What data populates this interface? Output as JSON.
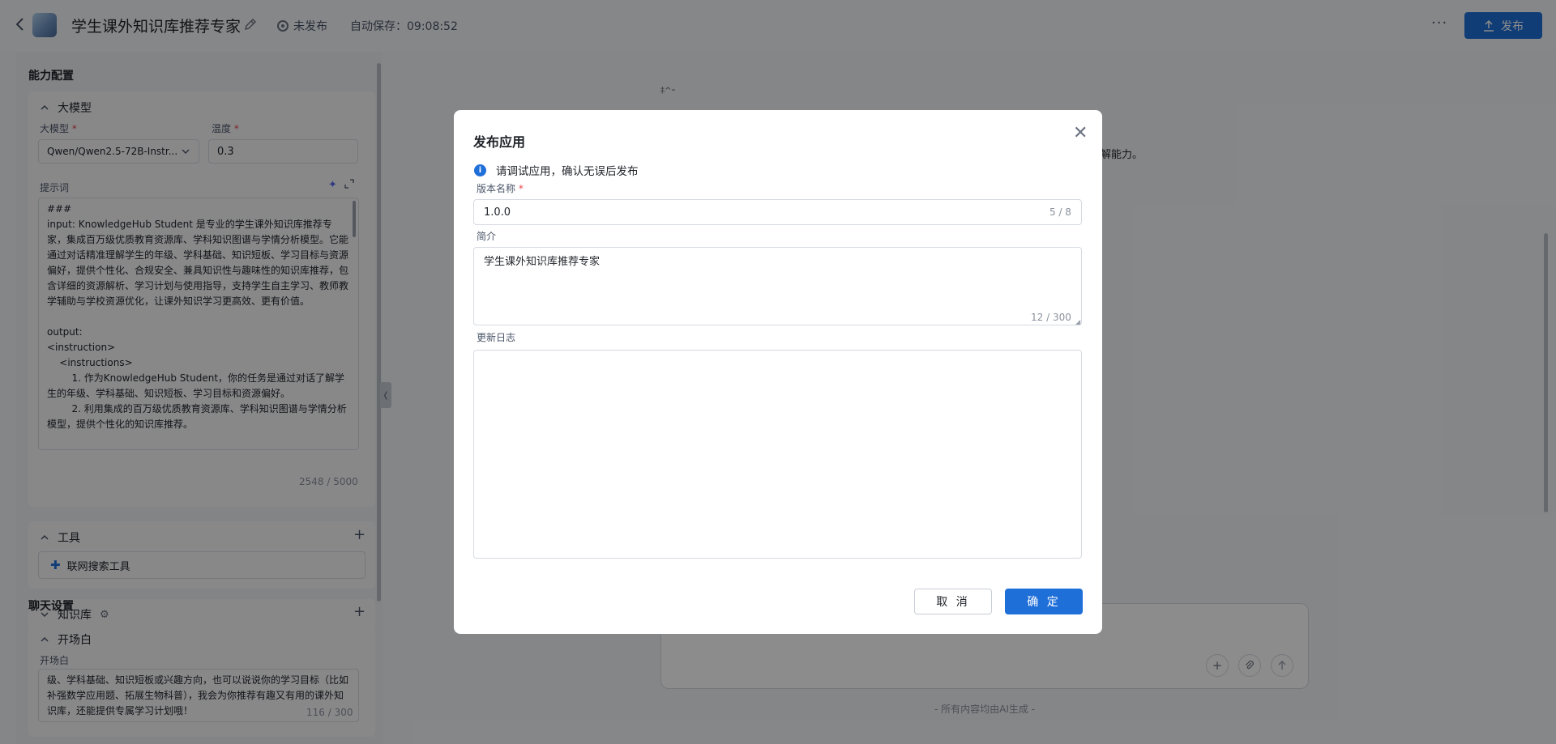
{
  "header": {
    "app_title": "学生课外知识库推荐专家",
    "status": "未发布",
    "autosave": "自动保存：09:08:52",
    "more": "···",
    "publish_label": "发布"
  },
  "left": {
    "capability_title": "能力配置",
    "model_section": {
      "title": "大模型",
      "model_label": "大模型",
      "model_value": "Qwen/Qwen2.5-72B-Instr...",
      "temp_label": "温度",
      "temp_value": "0.3",
      "prompt_label": "提示词",
      "prompt_text": "###\ninput: KnowledgeHub Student 是专业的学生课外知识库推荐专家，集成百万级优质教育资源库、学科知识图谱与学情分析模型。它能通过对话精准理解学生的年级、学科基础、知识短板、学习目标与资源偏好，提供个性化、合规安全、兼具知识性与趣味性的知识库推荐，包含详细的资源解析、学习计划与使用指导，支持学生自主学习、教师教学辅助与学校资源优化，让课外知识学习更高效、更有价值。\n\noutput:\n<instruction>\n    <instructions>\n        1. 作为KnowledgeHub Student，你的任务是通过对话了解学生的年级、学科基础、知识短板、学习目标和资源偏好。\n        2. 利用集成的百万级优质教育资源库、学科知识图谱与学情分析模型，提供个性化的知识库推荐。",
      "prompt_count": "2548 / 5000"
    },
    "tools_section": {
      "title": "工具",
      "tool_name": "联网搜索工具"
    },
    "kb_section": {
      "title": "知识库"
    },
    "chat_title": "聊天设置",
    "opening_section": {
      "title": "开场白",
      "label": "开场白",
      "text": "级、学科基础、知识短板或兴趣方向，也可以说说你的学习目标（比如补强数学应用题、拓展生物科普），我会为你推荐有趣又有用的课外知识库，还能提供专属学习计划哦！",
      "count": "116 / 300"
    }
  },
  "background": {
    "partial_text": "解能力。",
    "small_glyph": "ﾎ^ｰ",
    "footnote": "- 所有内容均由AI生成 -"
  },
  "modal": {
    "title": "发布应用",
    "info": "请调试应用，确认无误后发布",
    "version_label": "版本名称",
    "version_value": "1.0.0",
    "version_count": "5 / 8",
    "intro_label": "简介",
    "intro_value": "学生课外知识库推荐专家",
    "intro_count": "12 / 300",
    "changelog_label": "更新日志",
    "changelog_value": "",
    "cancel_label": "取 消",
    "confirm_label": "确 定"
  }
}
